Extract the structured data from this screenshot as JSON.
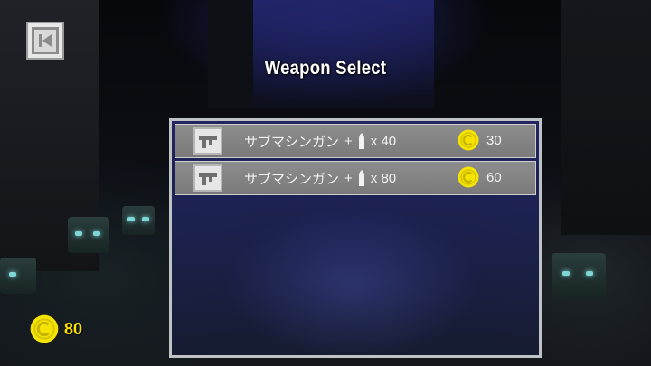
{
  "header": {
    "title": "Weapon Select"
  },
  "weapons": [
    {
      "icon": "submachine-gun-icon",
      "name": "サブマシンガン",
      "plus": "+",
      "ammo_icon": "bullet-icon",
      "ammo": "x 40",
      "price_icon": "coin-icon",
      "price": "30"
    },
    {
      "icon": "submachine-gun-icon",
      "name": "サブマシンガン",
      "plus": "+",
      "ammo_icon": "bullet-icon",
      "ammo": "x 80",
      "price_icon": "coin-icon",
      "price": "60"
    }
  ],
  "player": {
    "coin_icon": "coin-icon",
    "coins": "80"
  },
  "colors": {
    "coin": "#f5e400",
    "coin_text": "#ffe100",
    "row_bg": "#848484",
    "panel_border": "#bfc3c6"
  }
}
